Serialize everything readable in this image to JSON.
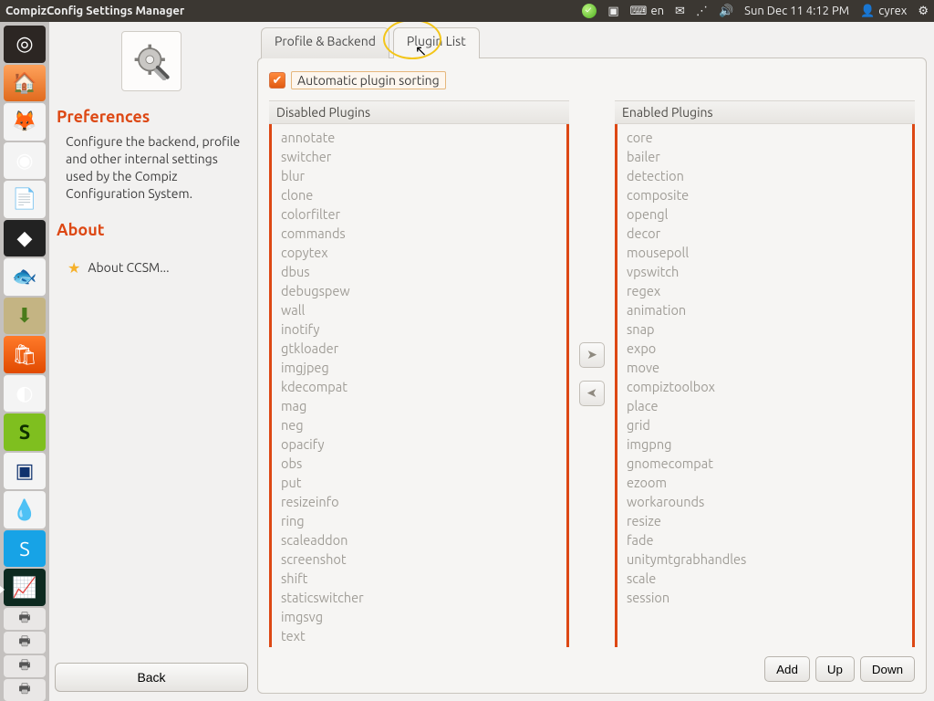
{
  "topbar": {
    "title": "CompizConfig Settings Manager",
    "lang": "en",
    "datetime": "Sun Dec 11  4:12 PM",
    "user": "cyrex"
  },
  "side": {
    "heading_prefs": "Preferences",
    "desc": "Configure the backend, profile and other internal settings used by the Compiz Configuration System.",
    "heading_about": "About",
    "about_link": "About CCSM...",
    "back": "Back"
  },
  "tabs": {
    "profile": "Profile & Backend",
    "plugin": "Plugin List"
  },
  "sorting_label": "Automatic plugin sorting",
  "headers": {
    "disabled": "Disabled Plugins",
    "enabled": "Enabled Plugins"
  },
  "disabled": [
    "annotate",
    "switcher",
    "blur",
    "clone",
    "colorfilter",
    "commands",
    "copytex",
    "dbus",
    "debugspew",
    "wall",
    "inotify",
    "gtkloader",
    "imgjpeg",
    "kdecompat",
    "mag",
    "neg",
    "opacify",
    "obs",
    "put",
    "resizeinfo",
    "ring",
    "scaleaddon",
    "screenshot",
    "shift",
    "staticswitcher",
    "imgsvg",
    "text"
  ],
  "enabled": [
    "core",
    "bailer",
    "detection",
    "composite",
    "opengl",
    "decor",
    "mousepoll",
    "vpswitch",
    "regex",
    "animation",
    "snap",
    "expo",
    "move",
    "compiztoolbox",
    "place",
    "grid",
    "imgpng",
    "gnomecompat",
    "ezoom",
    "workarounds",
    "resize",
    "fade",
    "unitymtgrabhandles",
    "scale",
    "session"
  ],
  "buttons": {
    "add": "Add",
    "up": "Up",
    "down": "Down"
  }
}
